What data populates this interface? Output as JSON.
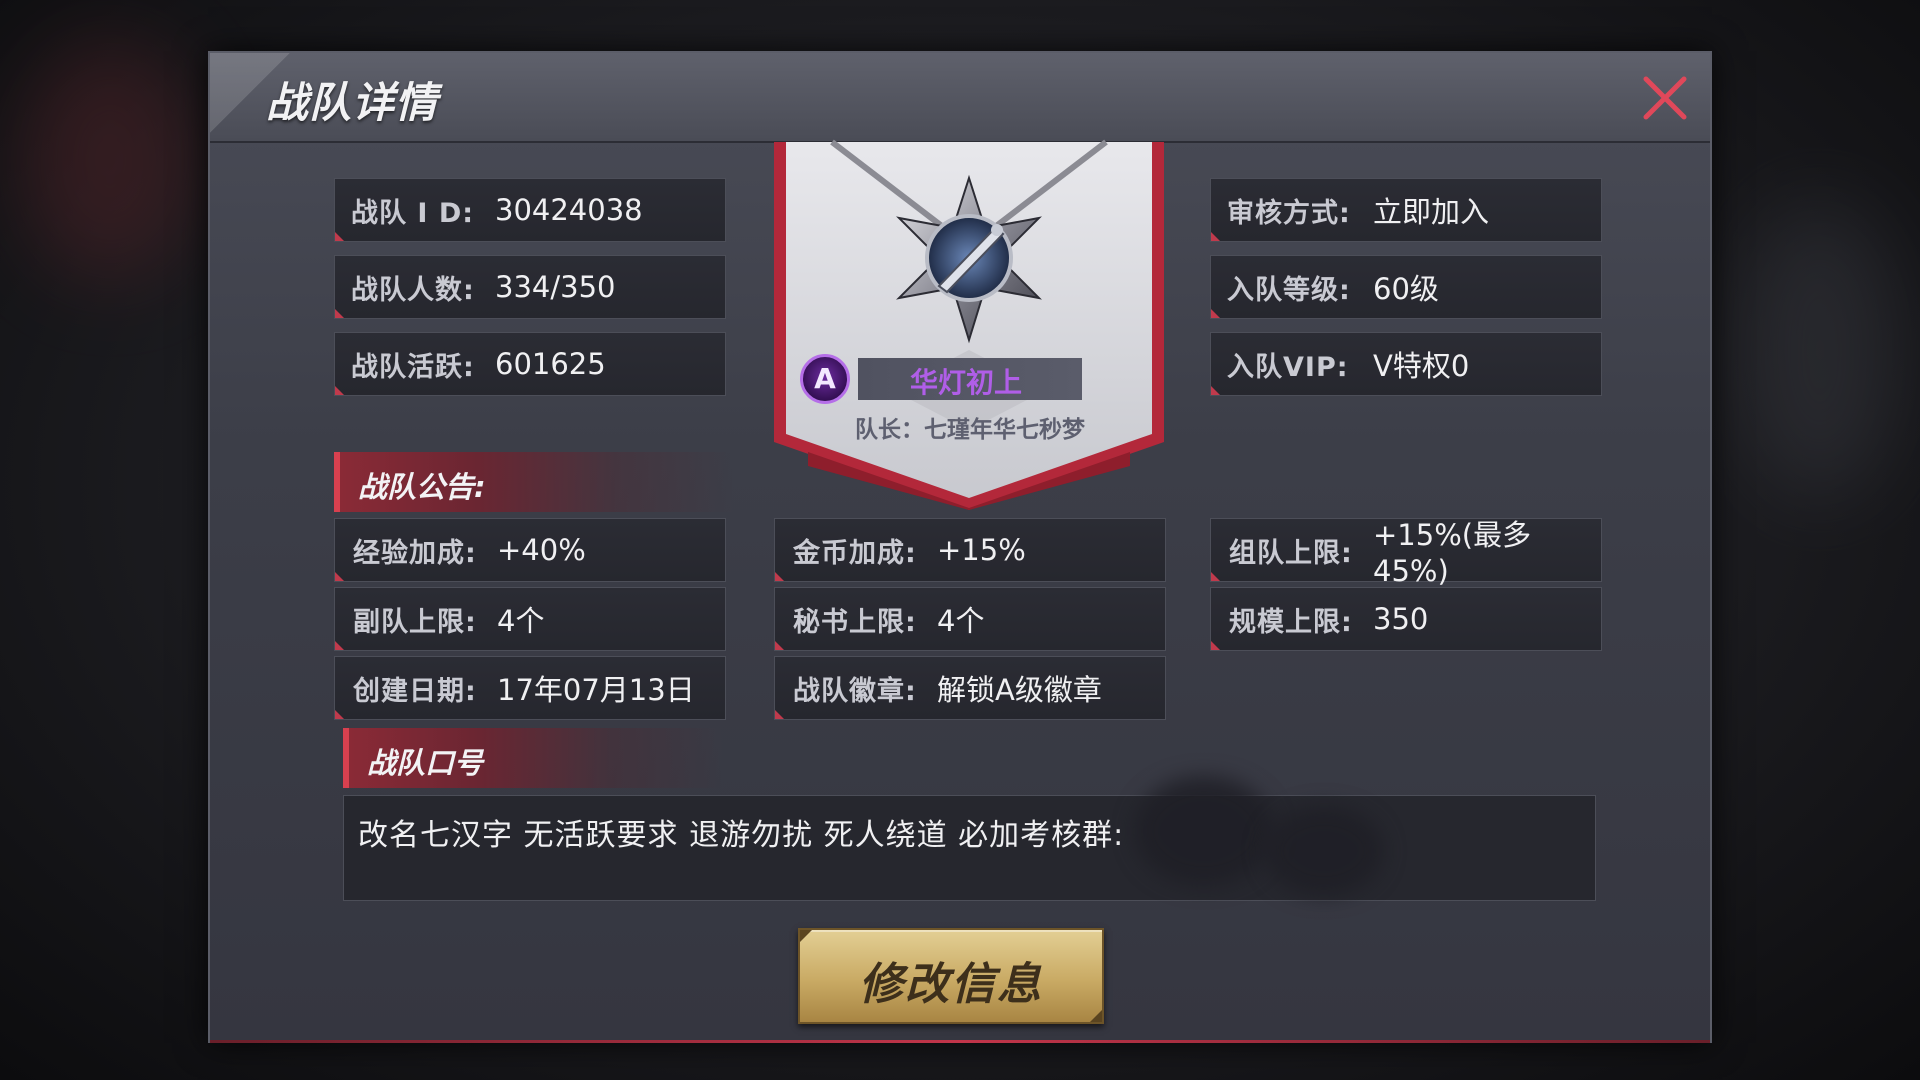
{
  "dialog": {
    "title": "战队详情",
    "close_icon": "close-icon"
  },
  "left_info": [
    {
      "label": "战队 I D:",
      "value": "30424038"
    },
    {
      "label": "战队人数:",
      "value": "334/350"
    },
    {
      "label": "战队活跃:",
      "value": "601625"
    }
  ],
  "right_info": [
    {
      "label": "审核方式:",
      "value": "立即加入"
    },
    {
      "label": "入队等级:",
      "value": "60级"
    },
    {
      "label": "入队VIP:",
      "value": "V特权0"
    }
  ],
  "badge": {
    "icon": "team-emblem-icon",
    "captain_icon_letter": "A",
    "team_name": "华灯初上",
    "leader": "队长：七瑾年华七秒梦"
  },
  "announcement": {
    "title": "战队公告:"
  },
  "bonuses": {
    "col1": [
      {
        "label": "经验加成:",
        "value": "+40%"
      },
      {
        "label": "副队上限:",
        "value": "4个"
      },
      {
        "label": "创建日期:",
        "value": "17年07月13日"
      }
    ],
    "col2": [
      {
        "label": "金币加成:",
        "value": "+15%"
      },
      {
        "label": "秘书上限:",
        "value": "4个"
      },
      {
        "label": "战队徽章:",
        "value": "解锁A级徽章"
      }
    ],
    "col3": [
      {
        "label": "组队上限:",
        "value": "+15%(最多45%)"
      },
      {
        "label": "规模上限:",
        "value": "350"
      }
    ]
  },
  "slogan": {
    "title": "战队口号",
    "text": "改名七汉字  无活跃要求 退游勿扰  死人绕道  必加考核群:"
  },
  "actions": {
    "edit_label": "修改信息"
  },
  "colors": {
    "accent_red": "#c03a4c",
    "gold_button": "#c9aa64",
    "team_name_purple": "#b05ee8"
  }
}
